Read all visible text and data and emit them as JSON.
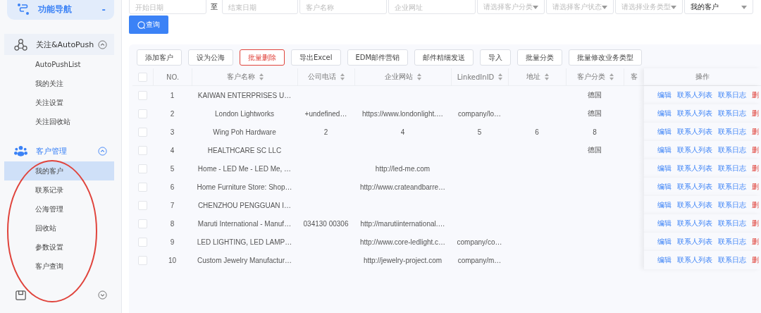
{
  "sidebar": {
    "header": {
      "label": "功能导航",
      "toggle": "-"
    },
    "groups": [
      {
        "label": "关注&AutoPush",
        "expanded": true,
        "active": false,
        "items": [
          {
            "label": "AutoPushList",
            "selected": false
          },
          {
            "label": "我的关注",
            "selected": false
          },
          {
            "label": "关注设置",
            "selected": false
          },
          {
            "label": "关注回收站",
            "selected": false
          }
        ]
      },
      {
        "label": "客户管理",
        "expanded": true,
        "active": true,
        "items": [
          {
            "label": "我的客户",
            "selected": true
          },
          {
            "label": "联系记录",
            "selected": false
          },
          {
            "label": "公海管理",
            "selected": false
          },
          {
            "label": "回收站",
            "selected": false
          },
          {
            "label": "参数设置",
            "selected": false
          },
          {
            "label": "客户查询",
            "selected": false
          }
        ]
      },
      {
        "expanded": false,
        "active": false
      }
    ]
  },
  "filters": [
    {
      "kind": "input",
      "placeholder": "开始日期"
    },
    {
      "kind": "sep",
      "label": "至"
    },
    {
      "kind": "input",
      "placeholder": "结束日期"
    },
    {
      "kind": "input",
      "placeholder": "客户名称"
    },
    {
      "kind": "input",
      "placeholder": "企业网址"
    },
    {
      "kind": "select",
      "placeholder": "请选择客户分类"
    },
    {
      "kind": "select",
      "placeholder": "请选择客户状态"
    },
    {
      "kind": "select",
      "placeholder": "请选择业务类型"
    },
    {
      "kind": "select",
      "value": "我的客户"
    }
  ],
  "search_button": "查询",
  "toolbar": [
    {
      "label": "添加客户",
      "kind": "normal"
    },
    {
      "label": "设为公海",
      "kind": "normal"
    },
    {
      "label": "批量删除",
      "kind": "danger"
    },
    {
      "label": "导出Excel",
      "kind": "normal"
    },
    {
      "label": "EDM邮件营销",
      "kind": "normal"
    },
    {
      "label": "邮件精细发送",
      "kind": "normal"
    },
    {
      "label": "导入",
      "kind": "normal"
    },
    {
      "label": "批量分类",
      "kind": "normal"
    },
    {
      "label": "批量修改业务类型",
      "kind": "normal"
    }
  ],
  "table": {
    "all_checked": false,
    "columns": [
      {
        "label": "NO.",
        "sortable": false
      },
      {
        "label": "客户名称",
        "sortable": true
      },
      {
        "label": "公司电话",
        "sortable": true
      },
      {
        "label": "企业网站",
        "sortable": true
      },
      {
        "label": "LinkedInID",
        "sortable": true
      },
      {
        "label": "地址",
        "sortable": true
      },
      {
        "label": "客户分类",
        "sortable": true
      },
      {
        "label": "客",
        "sortable": false
      }
    ],
    "actions_heading": "操作",
    "rows": [
      {
        "checked": false,
        "cells": [
          "1",
          "KAIWAN ENTERPRISES U…",
          null,
          null,
          null,
          null,
          "德国",
          null
        ],
        "actions": [
          {
            "label": "编辑",
            "kind": "link"
          },
          {
            "label": "联系人列表",
            "kind": "link"
          },
          {
            "label": "联系日志",
            "kind": "link"
          },
          {
            "label": "删",
            "kind": "danger"
          }
        ]
      },
      {
        "checked": false,
        "cells": [
          "2",
          "London Lightworks",
          "+undefined…",
          "https://www.londonlight.…",
          "company/lo…",
          null,
          "德国",
          null
        ],
        "actions": [
          {
            "label": "编辑",
            "kind": "link"
          },
          {
            "label": "联系人列表",
            "kind": "link"
          },
          {
            "label": "联系日志",
            "kind": "link"
          },
          {
            "label": "删",
            "kind": "danger"
          }
        ]
      },
      {
        "checked": false,
        "cells": [
          "3",
          "Wing Poh Hardware",
          "2",
          "4",
          "5",
          "6",
          "8",
          null
        ],
        "actions": [
          {
            "label": "编辑",
            "kind": "link"
          },
          {
            "label": "联系人列表",
            "kind": "link"
          },
          {
            "label": "联系日志",
            "kind": "link"
          },
          {
            "label": "删",
            "kind": "danger"
          }
        ]
      },
      {
        "checked": false,
        "cells": [
          "4",
          "HEALTHCARE SC LLC",
          null,
          null,
          null,
          null,
          "德国",
          null
        ],
        "actions": [
          {
            "label": "编辑",
            "kind": "link"
          },
          {
            "label": "联系人列表",
            "kind": "link"
          },
          {
            "label": "联系日志",
            "kind": "link"
          },
          {
            "label": "删",
            "kind": "danger"
          }
        ]
      },
      {
        "checked": false,
        "cells": [
          "5",
          "Home - LED Me - LED Me, …",
          null,
          "http://led-me.com",
          null,
          null,
          null,
          null
        ],
        "actions": [
          {
            "label": "编辑",
            "kind": "link"
          },
          {
            "label": "联系人列表",
            "kind": "link"
          },
          {
            "label": "联系日志",
            "kind": "link"
          },
          {
            "label": "删",
            "kind": "danger"
          }
        ]
      },
      {
        "checked": false,
        "cells": [
          "6",
          "Home Furniture Store: Shop…",
          null,
          "http://www.crateandbarre…",
          null,
          null,
          null,
          null
        ],
        "actions": [
          {
            "label": "编辑",
            "kind": "link"
          },
          {
            "label": "联系人列表",
            "kind": "link"
          },
          {
            "label": "联系日志",
            "kind": "link"
          },
          {
            "label": "删",
            "kind": "danger"
          }
        ]
      },
      {
        "checked": false,
        "cells": [
          "7",
          "CHENZHOU PENGGUAN I…",
          null,
          null,
          null,
          null,
          null,
          null
        ],
        "actions": [
          {
            "label": "编辑",
            "kind": "link"
          },
          {
            "label": "联系人列表",
            "kind": "link"
          },
          {
            "label": "联系日志",
            "kind": "link"
          },
          {
            "label": "删",
            "kind": "danger"
          }
        ]
      },
      {
        "checked": false,
        "cells": [
          "8",
          "Maruti International - Manuf…",
          "034130 00306",
          "http://marutiinternational.…",
          null,
          null,
          null,
          null
        ],
        "actions": [
          {
            "label": "编辑",
            "kind": "link"
          },
          {
            "label": "联系人列表",
            "kind": "link"
          },
          {
            "label": "联系日志",
            "kind": "link"
          },
          {
            "label": "删",
            "kind": "danger"
          }
        ]
      },
      {
        "checked": false,
        "cells": [
          "9",
          "LED LIGHTING, LED LAMP…",
          null,
          "http://www.core-ledlight.c…",
          "company/co…",
          null,
          null,
          null
        ],
        "actions": [
          {
            "label": "编辑",
            "kind": "link"
          },
          {
            "label": "联系人列表",
            "kind": "link"
          },
          {
            "label": "联系日志",
            "kind": "link"
          },
          {
            "label": "删",
            "kind": "danger"
          }
        ]
      },
      {
        "checked": false,
        "cells": [
          "10",
          "Custom Jewelry Manufactur…",
          null,
          "http://jewelry-project.com",
          "company/m…",
          null,
          null,
          null
        ],
        "actions": [
          {
            "label": "编辑",
            "kind": "link"
          },
          {
            "label": "联系人列表",
            "kind": "link"
          },
          {
            "label": "联系日志",
            "kind": "link"
          },
          {
            "label": "删",
            "kind": "danger"
          }
        ]
      }
    ]
  }
}
